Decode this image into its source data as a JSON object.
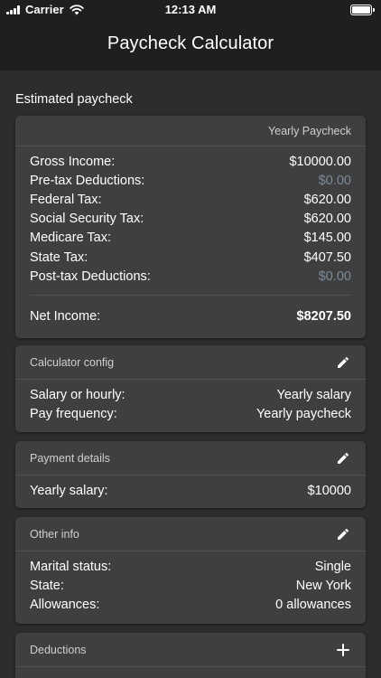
{
  "status_bar": {
    "carrier": "Carrier",
    "time": "12:13 AM"
  },
  "nav": {
    "title": "Paycheck Calculator"
  },
  "estimated": {
    "section_title": "Estimated paycheck",
    "header": "Yearly Paycheck",
    "rows": [
      {
        "label": "Gross Income:",
        "value": "$10000.00",
        "muted": false
      },
      {
        "label": "Pre-tax Deductions:",
        "value": "$0.00",
        "muted": true
      },
      {
        "label": "Federal Tax:",
        "value": "$620.00",
        "muted": false
      },
      {
        "label": "Social Security Tax:",
        "value": "$620.00",
        "muted": false
      },
      {
        "label": "Medicare Tax:",
        "value": "$145.00",
        "muted": false
      },
      {
        "label": "State Tax:",
        "value": "$407.50",
        "muted": false
      },
      {
        "label": "Post-tax Deductions:",
        "value": "$0.00",
        "muted": true
      }
    ],
    "net_label": "Net Income:",
    "net_value": "$8207.50"
  },
  "calculator_config": {
    "header": "Calculator config",
    "rows": [
      {
        "label": "Salary or hourly:",
        "value": "Yearly salary"
      },
      {
        "label": "Pay frequency:",
        "value": "Yearly paycheck"
      }
    ]
  },
  "payment_details": {
    "header": "Payment details",
    "rows": [
      {
        "label": "Yearly salary:",
        "value": "$10000"
      }
    ]
  },
  "other_info": {
    "header": "Other info",
    "rows": [
      {
        "label": "Marital status:",
        "value": "Single"
      },
      {
        "label": "State:",
        "value": "New York"
      },
      {
        "label": "Allowances:",
        "value": "0 allowances"
      }
    ]
  },
  "deductions": {
    "header": "Deductions"
  },
  "colors": {
    "background": "#2d2d2d",
    "bar": "#1f1f1f",
    "card": "#3f3f3f",
    "muted_value": "#7c8a9c"
  },
  "icons": {
    "edit": "pencil-icon",
    "add": "plus-icon"
  }
}
